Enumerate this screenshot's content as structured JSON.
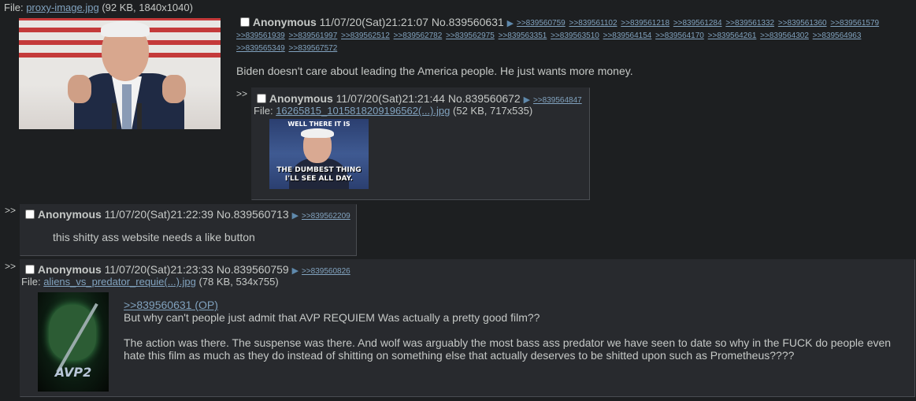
{
  "op": {
    "file_label": "File:",
    "file_name": "proxy-image.jpg",
    "file_meta": "(92 KB, 1840x1040)",
    "name": "Anonymous",
    "datetime": "11/07/20(Sat)21:21:07",
    "post_no": "No.839560631",
    "backlinks_row1": [
      ">>839560759",
      ">>839561102",
      ">>839561218",
      ">>839561284",
      ">>839561332",
      ">>839561360",
      ">>839561579"
    ],
    "backlinks_row2": [
      ">>839561939",
      ">>839561997",
      ">>839562512",
      ">>839562782",
      ">>839562975",
      ">>839563351",
      ">>839563510",
      ">>839564154",
      ">>839564170",
      ">>839564261",
      ">>839564302",
      ">>839564963"
    ],
    "backlinks_row3": [
      ">>839565349",
      ">>839567572"
    ],
    "message": "Biden doesn't care about leading the America people. He just wants more money."
  },
  "reply1": {
    "arrows": ">>",
    "name": "Anonymous",
    "datetime": "11/07/20(Sat)21:21:44",
    "post_no": "No.839560672",
    "backlink": ">>839564847",
    "file_label": "File:",
    "file_name": "16265815_1015818209196562(...).jpg",
    "file_meta": "(52 KB, 717x535)",
    "image_text_top": "WELL THERE IT IS",
    "image_text_bottom": "THE DUMBEST THING I'LL SEE ALL DAY."
  },
  "reply2": {
    "arrows": ">>",
    "name": "Anonymous",
    "datetime": "11/07/20(Sat)21:22:39",
    "post_no": "No.839560713",
    "backlink": ">>839562209",
    "message": "this shitty ass website needs a like button"
  },
  "reply3": {
    "arrows": ">>",
    "name": "Anonymous",
    "datetime": "11/07/20(Sat)21:23:33",
    "post_no": "No.839560759",
    "backlink": ">>839560826",
    "file_label": "File:",
    "file_name": "aliens_vs_predator_requie(...).jpg",
    "file_meta": "(78 KB, 534x755)",
    "quote": ">>839560631 (OP)",
    "line1": "But why can't people just admit that AVP REQUIEM Was actually a pretty good film??",
    "line2": "The action was there. The suspense was there. And wolf was arguably the most bass ass predator we have seen to date so why in the FUCK do people even hate this film as much as they do instead of shitting on something else that actually deserves to be shitted upon such as Prometheus????",
    "image_logo": "AVP2"
  },
  "colors": {
    "background": "#1d1f21",
    "reply_bg": "#282a2e",
    "text": "#c5c8c6",
    "link": "#81a2be"
  },
  "icons": [
    "checkbox-icon",
    "play-arrow-icon"
  ]
}
